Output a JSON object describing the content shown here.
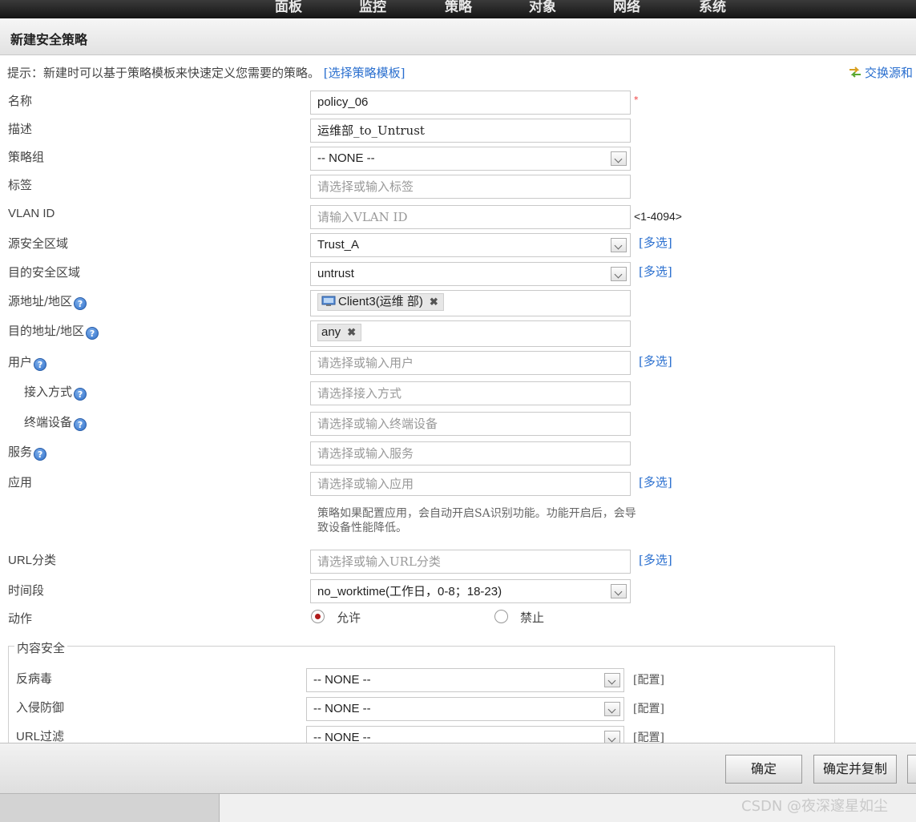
{
  "nav": [
    "面板",
    "监控",
    "策略",
    "对象",
    "网络",
    "系统"
  ],
  "header": {
    "title": "新建安全策略"
  },
  "tip": {
    "text": "提示：新建时可以基于策略模板来快速定义您需要的策略。",
    "link": "[选择策略模板]"
  },
  "swap_label": "交换源和",
  "form": {
    "name": {
      "label": "名称",
      "value": "policy_06",
      "required_mark": "*"
    },
    "description": {
      "label": "描述",
      "value": "运维部_to_Untrust"
    },
    "policy_group": {
      "label": "策略组",
      "value": "-- NONE --"
    },
    "tags": {
      "label": "标签",
      "placeholder": "请选择或输入标签"
    },
    "vlan_id": {
      "label": "VLAN ID",
      "placeholder": "请输入VLAN ID",
      "range": "<1-4094>"
    },
    "src_zone": {
      "label": "源安全区域",
      "value": "Trust_A",
      "multi": "[多选]"
    },
    "dst_zone": {
      "label": "目的安全区域",
      "value": "untrust",
      "multi": "[多选]"
    },
    "src_addr": {
      "label": "源地址/地区",
      "tag": "Client3(运维 部)"
    },
    "dst_addr": {
      "label": "目的地址/地区",
      "tag": "any"
    },
    "user": {
      "label": "用户",
      "placeholder": "请选择或输入用户",
      "multi": "[多选]"
    },
    "access_mode": {
      "label": "接入方式",
      "placeholder": "请选择接入方式"
    },
    "terminal": {
      "label": "终端设备",
      "placeholder": "请选择或输入终端设备"
    },
    "service": {
      "label": "服务",
      "placeholder": "请选择或输入服务"
    },
    "application": {
      "label": "应用",
      "placeholder": "请选择或输入应用",
      "multi": "[多选]",
      "note": "策略如果配置应用，会自动开启SA识别功能。功能开启后，会导致设备性能降低。"
    },
    "url_category": {
      "label": "URL分类",
      "placeholder": "请选择或输入URL分类",
      "multi": "[多选]"
    },
    "schedule": {
      "label": "时间段",
      "value_prefix": "no_worktime(",
      "value_cn": "工作日，",
      "value_suffix": "0-8；18-23)"
    },
    "action": {
      "label": "动作",
      "allow": "允许",
      "deny": "禁止",
      "selected": "allow"
    }
  },
  "content_security": {
    "legend": "内容安全",
    "rows": [
      {
        "label": "反病毒",
        "value": "-- NONE --",
        "config": "[配置]"
      },
      {
        "label": "入侵防御",
        "value": "-- NONE --",
        "config": "[配置]"
      },
      {
        "label": "URL过滤",
        "value": "-- NONE --",
        "config": "[配置]"
      }
    ]
  },
  "buttons": {
    "ok": "确定",
    "ok_copy": "确定并复制"
  },
  "watermark": "CSDN @夜深邃星如尘",
  "icons": {
    "help": "help-icon",
    "swap": "swap-icon",
    "pc": "computer-icon",
    "remove": "remove-icon",
    "dropdown": "chevron-down-icon"
  }
}
